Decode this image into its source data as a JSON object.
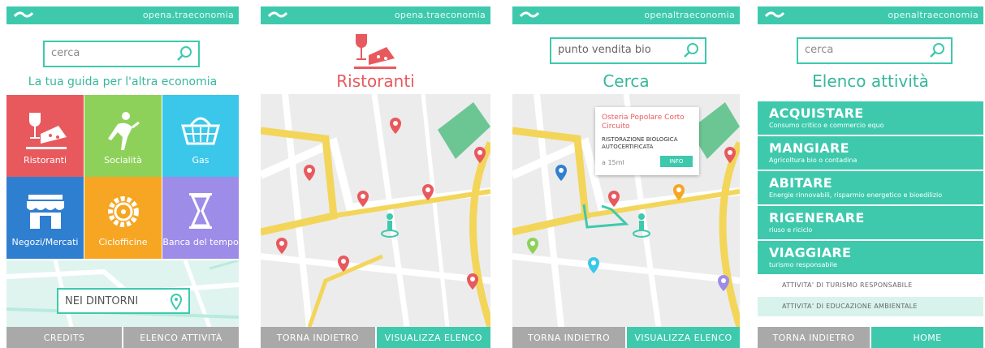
{
  "colors": {
    "accent": "#3ec9ad",
    "red": "#e8595e",
    "green": "#8ed15a",
    "blue": "#3bc7ea",
    "navy": "#2f7fd1",
    "orange": "#f6a623",
    "purple": "#9d8ce8",
    "grey": "#a9a9a9"
  },
  "screen1": {
    "site": "opena.traeconomia",
    "search_placeholder": "cerca",
    "tagline": "La tua guida per l'altra economia",
    "tiles": [
      {
        "label": "Ristoranti",
        "icon": "restaurant-icon"
      },
      {
        "label": "Socialità",
        "icon": "social-icon"
      },
      {
        "label": "Gas",
        "icon": "basket-icon"
      },
      {
        "label": "Negozi/Mercati",
        "icon": "shop-icon"
      },
      {
        "label": "Ciclofficine",
        "icon": "gear-icon"
      },
      {
        "label": "Banca del tempo",
        "icon": "hourglass-icon"
      }
    ],
    "nearby": "NEI DINTORNI",
    "buttons": [
      "CREDITS",
      "ELENCO ATTIVITÀ"
    ]
  },
  "screen2": {
    "site": "opena.traeconomia",
    "title": "Ristoranti",
    "buttons": [
      "TORNA INDIETRO",
      "VISUALIZZA ELENCO"
    ]
  },
  "screen3": {
    "site": "openaltraeconomia",
    "search_value": "punto vendita bio",
    "title": "Cerca",
    "popup": {
      "name": "Osteria Popolare Corto Circuito",
      "desc": "RISTORAZIONE BIOLOGICA AUTOCERTIFICATA",
      "distance": "a 15ml",
      "info": "INFO"
    },
    "buttons": [
      "TORNA INDIETRO",
      "VISUALIZZA ELENCO"
    ]
  },
  "screen4": {
    "site": "openaltraeconomia",
    "search_placeholder": "cerca",
    "title": "Elenco attività",
    "activities": [
      {
        "title": "ACQUISTARE",
        "subtitle": "Consumo critico e commercio equo"
      },
      {
        "title": "MANGIARE",
        "subtitle": "Agricoltura bio o contadina"
      },
      {
        "title": "ABITARE",
        "subtitle": "Energie rinnovabili, risparmio energetico e bioedilizio"
      },
      {
        "title": "RIGENERARE",
        "subtitle": "riuso e riciclo"
      },
      {
        "title": "VIAGGIARE",
        "subtitle": "turismo responsabile"
      }
    ],
    "subitems": [
      "ATTIVITA' DI TURISMO RESPONSABILE",
      "ATTIVITA' DI EDUCAZIONE AMBIENTALE"
    ],
    "buttons": [
      "TORNA INDIETRO",
      "HOME"
    ]
  }
}
